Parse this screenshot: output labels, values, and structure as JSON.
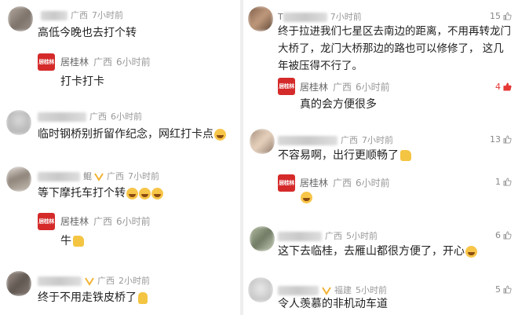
{
  "left": {
    "comments": [
      {
        "location": "广西",
        "time": "7小时前",
        "text": "高低今晚也去打个转",
        "reply": {
          "name": "居桂林",
          "location": "广西",
          "time": "6小时前",
          "text": "打卡打卡"
        }
      },
      {
        "location": "广西",
        "time": "6小时前",
        "text": "临时钢桥别折留作纪念，网红打卡点"
      },
      {
        "partial_name": "鲲",
        "location": "广西",
        "time": "7小时前",
        "text": "等下摩托车打个转",
        "reply": {
          "name": "居桂林",
          "location": "广西",
          "time": "6小时前",
          "text": "牛"
        }
      },
      {
        "location": "广西",
        "time": "2小时前",
        "text": "终于不用走铁皮桥了"
      }
    ]
  },
  "right": {
    "comments": [
      {
        "partial_name": "T",
        "time": "7小时前",
        "likes": "15",
        "text_lines": [
          "终于拉进我们七星区去南边的距离，不用再转龙门",
          "大桥了，龙门大桥那边的路也可以修修了， 这几",
          "年被压得不行了。"
        ],
        "reply": {
          "name": "居桂林",
          "location": "广西",
          "time": "6小时前",
          "text": "真的会方便很多",
          "likes": "4"
        }
      },
      {
        "location": "广西",
        "time": "7小时前",
        "likes": "13",
        "text": "不容易啊，出行更顺畅了",
        "reply": {
          "name": "居桂林",
          "location": "广西",
          "time": "6小时前",
          "likes": "1"
        }
      },
      {
        "location": "广西",
        "time": "5小时前",
        "likes": "6",
        "text": "这下去临桂，去雁山都很方便了，开心"
      },
      {
        "location": "福建",
        "time": "5小时前",
        "likes": "5",
        "text": "令人羡慕的非机动车道"
      }
    ]
  },
  "logo_text": "居桂林",
  "colors": {
    "brand_red": "#d52a2a",
    "like_red": "#e53935",
    "meta_grey": "#999999"
  }
}
